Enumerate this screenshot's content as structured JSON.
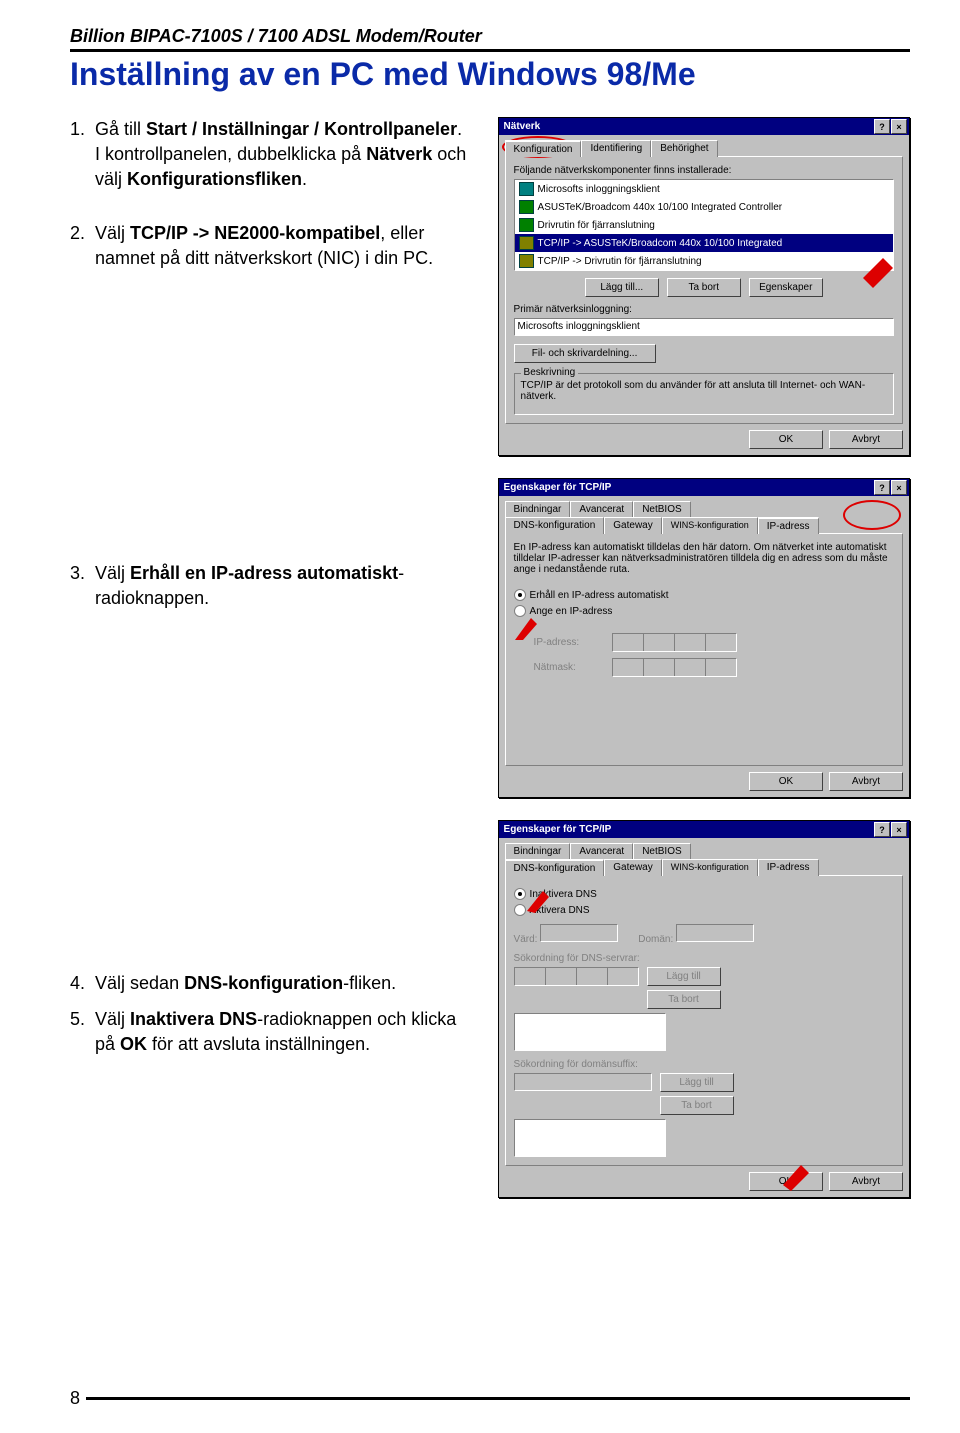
{
  "header": "Billion BIPAC-7100S / 7100 ADSL Modem/Router",
  "title": "Inställning av en PC med Windows 98/Me",
  "steps": {
    "s1a": "Gå till ",
    "s1b": "Start / Inställningar / Kontrollpaneler",
    "s1c": ". I kontrollpanelen, dubbelklicka på ",
    "s1d": "Nätverk",
    "s1e": " och välj ",
    "s1f": "Konfigurationsfliken",
    "s1g": ".",
    "s2a": "Välj ",
    "s2b": "TCP/IP -> NE2000-kompatibel",
    "s2c": ", eller namnet på ditt nätverkskort (NIC) i din PC.",
    "s3a": "Välj ",
    "s3b": "Erhåll en IP-adress automatiskt",
    "s3c": "-radioknappen.",
    "s4a": "Välj sedan ",
    "s4b": "DNS-konfiguration",
    "s4c": "-fliken.",
    "s5a": "Välj ",
    "s5b": "Inaktivera DNS",
    "s5c": "-radioknappen och klicka på ",
    "s5d": "OK",
    "s5e": " för att avsluta inställningen."
  },
  "dlg1": {
    "title": "Nätverk",
    "tabs": [
      "Konfiguration",
      "Identifiering",
      "Behörighet"
    ],
    "listlabel": "Följande nätverkskomponenter finns installerade:",
    "items": [
      "Microsofts inloggningsklient",
      "ASUSTeK/Broadcom 440x 10/100 Integrated Controller",
      "Drivrutin för fjärranslutning",
      "TCP/IP -> ASUSTeK/Broadcom 440x 10/100 Integrated",
      "TCP/IP -> Drivrutin för fjärranslutning"
    ],
    "btn_add": "Lägg till...",
    "btn_del": "Ta bort",
    "btn_prop": "Egenskaper",
    "login_lbl": "Primär nätverksinloggning:",
    "login_val": "Microsofts inloggningsklient",
    "share": "Fil- och skrivardelning...",
    "desc_cap": "Beskrivning",
    "desc": "TCP/IP är det protokoll som du använder för att ansluta till Internet- och WAN-nätverk.",
    "ok": "OK",
    "cancel": "Avbryt"
  },
  "dlg2": {
    "title": "Egenskaper för TCP/IP",
    "tabs_top": [
      "Bindningar",
      "Avancerat",
      "NetBIOS"
    ],
    "tabs_bot": [
      "DNS-konfiguration",
      "Gateway",
      "WINS-konfiguration",
      "IP-adress"
    ],
    "desc": "En IP-adress kan automatiskt tilldelas den här datorn. Om nätverket inte automatiskt tilldelar IP-adresser kan nätverksadministratören tilldela dig en adress som du måste ange i nedanstående ruta.",
    "r1": "Erhåll en IP-adress automatiskt",
    "r2": "Ange en IP-adress",
    "ip_lbl": "IP-adress:",
    "mask_lbl": "Nätmask:",
    "ok": "OK",
    "cancel": "Avbryt"
  },
  "dlg3": {
    "title": "Egenskaper för TCP/IP",
    "tabs_top": [
      "Bindningar",
      "Avancerat",
      "NetBIOS"
    ],
    "tabs_bot": [
      "DNS-konfiguration",
      "Gateway",
      "WINS-konfiguration",
      "IP-adress"
    ],
    "r1": "Inaktivera DNS",
    "r2": "Aktivera DNS",
    "host_lbl": "Värd:",
    "domain_lbl": "Domän:",
    "order1": "Sökordning för DNS-servrar:",
    "order2": "Sökordning för domänsuffix:",
    "add": "Lägg till",
    "del": "Ta bort",
    "ok": "OK",
    "cancel": "Avbryt"
  },
  "pagenum": "8"
}
